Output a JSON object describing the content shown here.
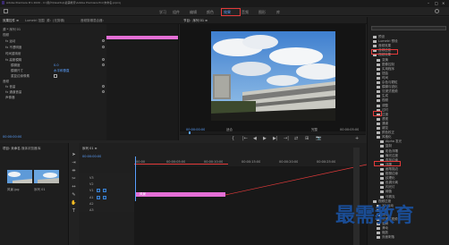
{
  "window": {
    "title": "Adobe Premiere Pro 2020 - C:\\用户\\Desktop\\最需教育\\Adobe Premiere Pro\\未命名.prproj"
  },
  "workspaces": {
    "tabs": [
      {
        "label": "学习",
        "active": false
      },
      {
        "label": "组件",
        "active": false
      },
      {
        "label": "编辑",
        "active": false
      },
      {
        "label": "颜色",
        "active": false
      },
      {
        "label": "效果",
        "active": true
      },
      {
        "label": "音频",
        "active": false
      },
      {
        "label": "图形",
        "active": false
      },
      {
        "label": "库",
        "active": false
      }
    ]
  },
  "panels": {
    "effect_controls": "效果控件 ≡",
    "lumetri_scopes": "Lumetri 范围",
    "source": "源：(无剪辑)",
    "audio_mixer": "音频剪辑混合器：",
    "program": "节目：序列 01 ≡",
    "effects": "效果 ≡"
  },
  "effect_controls": {
    "source_line": "源 * 序列 01",
    "clip_timecode": "00:00",
    "rows": [
      {
        "label": "视频",
        "value": ""
      },
      {
        "label": "fx 运动",
        "value": ""
      },
      {
        "label": "fx 不透明度",
        "value": ""
      },
      {
        "label": "时间重映射",
        "value": ""
      },
      {
        "label": "fx 高斯模糊",
        "value": ""
      },
      {
        "label": "模糊度",
        "value": "0.0"
      },
      {
        "label": "模糊尺寸",
        "value": "水平和垂直"
      },
      {
        "label": "重复边缘像素",
        "value": ""
      },
      {
        "label": "音频",
        "value": ""
      },
      {
        "label": "fx 音量",
        "value": ""
      },
      {
        "label": "fx 通道音量",
        "value": ""
      },
      {
        "label": "声像器",
        "value": ""
      }
    ],
    "timecode": "00:00:00:00"
  },
  "program": {
    "timecode": "00:00:00:00",
    "fit": "适合",
    "quality": "完整",
    "duration": "00:00:05:00"
  },
  "transport": [
    "{",
    "|←",
    "◀",
    "▶",
    "▶|",
    "→|",
    "⇄",
    "⊞",
    "📷",
    "+"
  ],
  "project": {
    "tabs": [
      "项目: 未命名",
      "媒体浏览器",
      "库"
    ],
    "items": [
      "风景.jpg",
      "序列 01"
    ]
  },
  "timeline": {
    "tab": "序列 01 ≡",
    "timecode": "00:00:00:00",
    "ruler_ticks": [
      "00:00",
      "00:00:05:00",
      "00:00:10:00",
      "00:00:15:00",
      "00:00:20:00",
      "00:00:25:00"
    ],
    "tracks": [
      "V3",
      "V2",
      "V1",
      "A1",
      "A2",
      "A3"
    ],
    "clip_label": "风景"
  },
  "effects_tree": [
    {
      "label": "预设",
      "indent": 0
    },
    {
      "label": "Lumetri 预设",
      "indent": 0
    },
    {
      "label": "音频效果",
      "indent": 0
    },
    {
      "label": "音频过渡",
      "indent": 0
    },
    {
      "label": "视频效果",
      "indent": 0
    },
    {
      "label": "变换",
      "indent": 1
    },
    {
      "label": "图像控制",
      "indent": 1
    },
    {
      "label": "实用程序",
      "indent": 1
    },
    {
      "label": "扭曲",
      "indent": 1
    },
    {
      "label": "时间",
      "indent": 1
    },
    {
      "label": "杂色与颗粒",
      "indent": 1
    },
    {
      "label": "模糊与锐化",
      "indent": 1
    },
    {
      "label": "沉浸式视频",
      "indent": 1
    },
    {
      "label": "生成",
      "indent": 1
    },
    {
      "label": "视频",
      "indent": 1
    },
    {
      "label": "调整",
      "indent": 1
    },
    {
      "label": "过时",
      "indent": 1
    },
    {
      "label": "过渡",
      "indent": 1
    },
    {
      "label": "透视",
      "indent": 1
    },
    {
      "label": "通道",
      "indent": 1
    },
    {
      "label": "键控",
      "indent": 1
    },
    {
      "label": "颜色校正",
      "indent": 1
    },
    {
      "label": "风格化",
      "indent": 1
    },
    {
      "label": "Alpha 发光",
      "indent": 2
    },
    {
      "label": "复制",
      "indent": 2
    },
    {
      "label": "彩色浮雕",
      "indent": 2
    },
    {
      "label": "曝光过度",
      "indent": 2
    },
    {
      "label": "查找边缘",
      "indent": 2
    },
    {
      "label": "浮雕",
      "indent": 2
    },
    {
      "label": "画笔描边",
      "indent": 2
    },
    {
      "label": "粗糙边缘",
      "indent": 2
    },
    {
      "label": "纹理化",
      "indent": 2
    },
    {
      "label": "色调分离",
      "indent": 2
    },
    {
      "label": "闪光灯",
      "indent": 2
    },
    {
      "label": "阈值",
      "indent": 2
    },
    {
      "label": "马赛克",
      "indent": 2
    },
    {
      "label": "视频过渡",
      "indent": 0
    },
    {
      "label": "3D 运动",
      "indent": 1
    },
    {
      "label": "划像",
      "indent": 1
    },
    {
      "label": "擦除",
      "indent": 1
    },
    {
      "label": "沉浸式视频",
      "indent": 1
    },
    {
      "label": "溶解",
      "indent": 1
    },
    {
      "label": "滑动",
      "indent": 1
    },
    {
      "label": "缩放",
      "indent": 1
    },
    {
      "label": "页面剥落",
      "indent": 1
    }
  ],
  "watermark": "最需教育",
  "colors": {
    "accent": "#5aa0ff",
    "highlight": "#e23a3a",
    "clip": "#e46fd6"
  }
}
